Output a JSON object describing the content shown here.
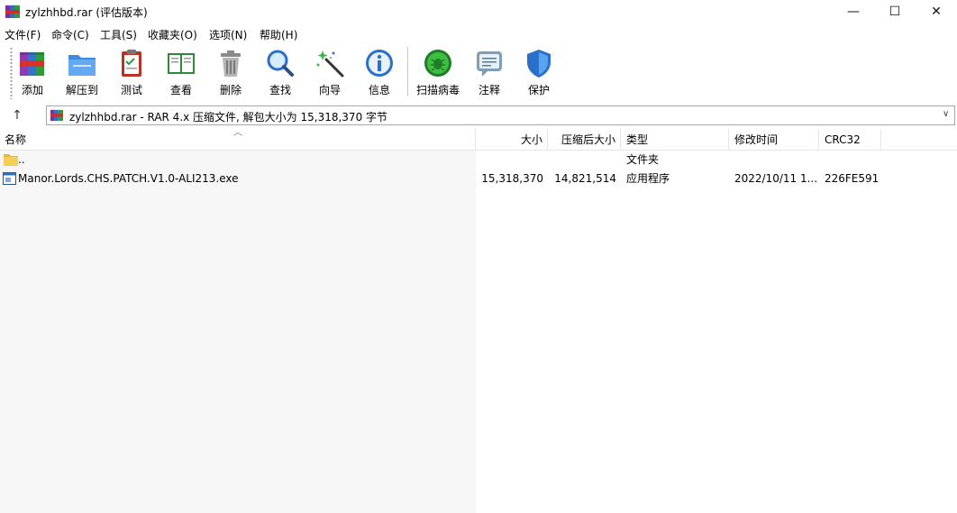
{
  "window": {
    "title": "zylzhhbd.rar (评估版本)",
    "minimize_glyph": "—",
    "maximize_glyph": "☐",
    "close_glyph": "✕"
  },
  "menu": [
    "文件(F)",
    "命令(C)",
    "工具(S)",
    "收藏夹(O)",
    "选项(N)",
    "帮助(H)"
  ],
  "toolbar": [
    {
      "label": "添加",
      "icon": "add-books-icon"
    },
    {
      "label": "解压到",
      "icon": "extract-folder-icon"
    },
    {
      "label": "测试",
      "icon": "test-clipboard-icon"
    },
    {
      "label": "查看",
      "icon": "view-book-icon"
    },
    {
      "label": "删除",
      "icon": "trash-icon"
    },
    {
      "label": "查找",
      "icon": "magnifier-icon"
    },
    {
      "label": "向导",
      "icon": "wizard-wand-icon"
    },
    {
      "label": "信息",
      "icon": "info-icon"
    },
    {
      "label": "扫描病毒",
      "icon": "virus-scan-icon"
    },
    {
      "label": "注释",
      "icon": "comment-icon"
    },
    {
      "label": "保护",
      "icon": "shield-icon"
    }
  ],
  "address": {
    "up_glyph": "↑",
    "text": "zylzhhbd.rar - RAR 4.x 压缩文件, 解包大小为 15,318,370 字节",
    "dropdown_glyph": "∨"
  },
  "columns": {
    "name": "名称",
    "size": "大小",
    "packed": "压缩后大小",
    "type": "类型",
    "modified": "修改时间",
    "crc": "CRC32",
    "sort_glyph": "︿"
  },
  "files": [
    {
      "name": "..",
      "size": "",
      "packed": "",
      "type": "文件夹",
      "modified": "",
      "crc": "",
      "icon": "folder-icon"
    },
    {
      "name": "Manor.Lords.CHS.PATCH.V1.0-ALI213.exe",
      "size": "15,318,370",
      "packed": "14,821,514",
      "type": "应用程序",
      "modified": "2022/10/11 1...",
      "crc": "226FE591",
      "icon": "exe-icon"
    }
  ],
  "colors": {
    "accent": "#1e6fd9",
    "folder": "#f3c851",
    "scan_green": "#2da52d",
    "shield_blue": "#3a8ee6"
  }
}
